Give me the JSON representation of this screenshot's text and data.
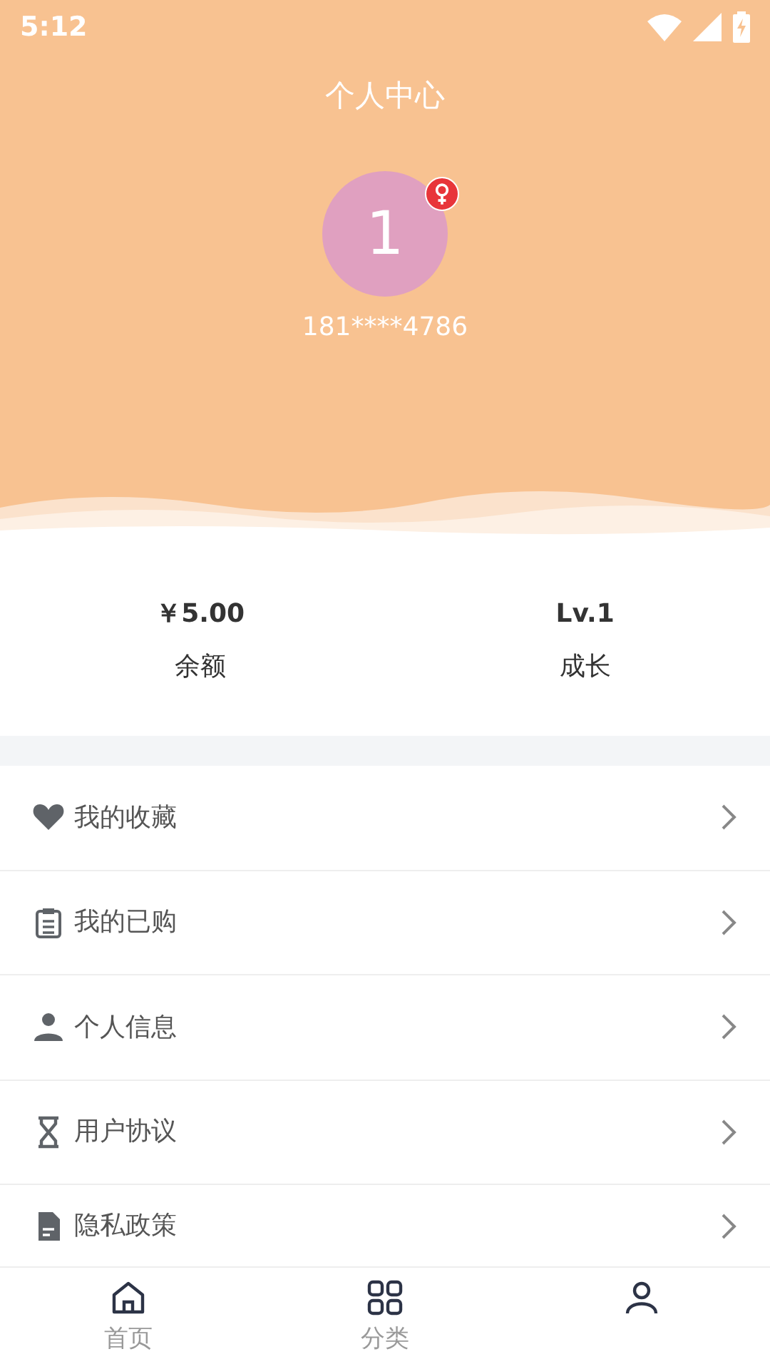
{
  "status_bar": {
    "time": "5:12"
  },
  "header": {
    "title": "个人中心",
    "avatar_text": "1",
    "phone": "181****4786"
  },
  "stats": [
    {
      "value": "￥5.00",
      "label": "余额"
    },
    {
      "value": "Lv.1",
      "label": "成长"
    }
  ],
  "menu": [
    {
      "kind": "heart",
      "label": "我的收藏"
    },
    {
      "kind": "clipboard",
      "label": "我的已购"
    },
    {
      "kind": "person",
      "label": "个人信息"
    },
    {
      "kind": "hourglass",
      "label": "用户协议"
    },
    {
      "kind": "document",
      "label": "隐私政策"
    }
  ],
  "tabs": [
    {
      "kind": "home",
      "label": "首页"
    },
    {
      "kind": "grid",
      "label": "分类"
    },
    {
      "kind": "person"
    }
  ]
}
